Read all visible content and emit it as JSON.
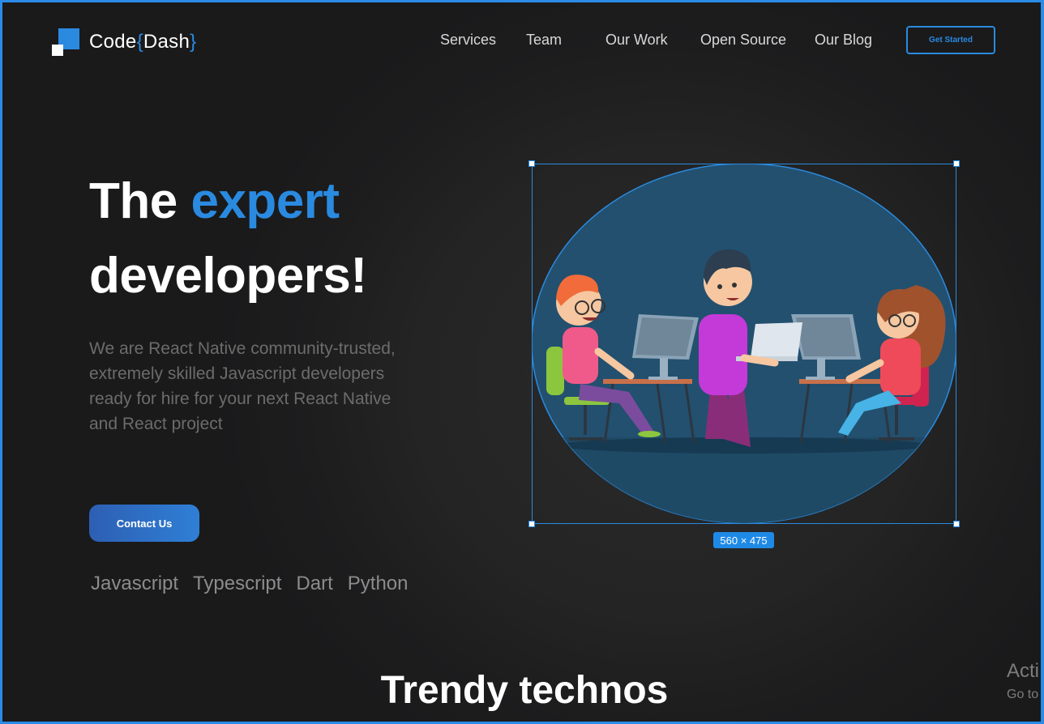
{
  "brand": {
    "name_prefix": "Code",
    "brace_open": "{",
    "name_suffix": "Dash",
    "brace_close": "}"
  },
  "nav": {
    "items": [
      "Services",
      "Team",
      "Our Work",
      "Open Source",
      "Our Blog"
    ],
    "cta_label": "Get Started"
  },
  "hero": {
    "title_word1": "The",
    "title_word2": "expert",
    "title_line2": "developers!",
    "description": "We are React Native community-trusted, extremely skilled Javascript developers ready for hire for your next React Native and React project",
    "contact_label": "Contact Us",
    "technologies": [
      "Javascript",
      "Typescript",
      "Dart",
      "Python"
    ]
  },
  "illustration": {
    "dimension_label": "560 × 475",
    "icon": "developers-team-illustration"
  },
  "section": {
    "title": "Trendy technos"
  },
  "overlay": {
    "activate_title": "Acti",
    "activate_sub": "Go to"
  },
  "colors": {
    "accent": "#2a8ae0",
    "background": "#1b1b1c",
    "circle": "#23506f"
  }
}
